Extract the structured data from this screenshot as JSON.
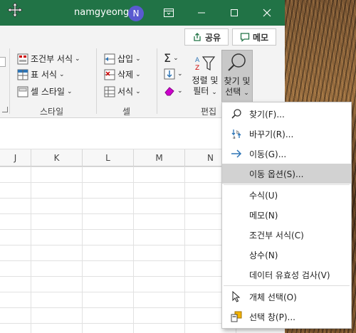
{
  "titlebar": {
    "username": "namgyeong",
    "avatar_initial": "N"
  },
  "ribbon": {
    "share_label": "공유",
    "memo_label": "메모",
    "styles": {
      "conditional_format": "조건부 서식",
      "table_format": "표 서식",
      "cell_style": "셀 스타일",
      "group_label": "스타일"
    },
    "cells": {
      "insert": "삽입",
      "delete": "삭제",
      "format": "서식",
      "group_label": "셀"
    },
    "editing": {
      "sort_filter_line1": "정렬 및",
      "sort_filter_line2": "필터",
      "find_select_line1": "찾기 및",
      "find_select_line2": "선택",
      "group_label": "편집"
    }
  },
  "columns": [
    "J",
    "K",
    "L",
    "M",
    "N"
  ],
  "menu": {
    "items": [
      {
        "label": "찾기(F)...",
        "icon": "search-icon"
      },
      {
        "label": "바꾸기(R)...",
        "icon": "replace-icon"
      },
      {
        "label": "이동(G)...",
        "icon": "arrow-right-icon"
      },
      {
        "label": "이동 옵션(S)...",
        "icon": "",
        "highlighted": true
      },
      {
        "label": "수식(U)",
        "icon": ""
      },
      {
        "label": "메모(N)",
        "icon": ""
      },
      {
        "label": "조건부 서식(C)",
        "icon": ""
      },
      {
        "label": "상수(N)",
        "icon": ""
      },
      {
        "label": "데이터 유효성 검사(V)",
        "icon": ""
      },
      {
        "label": "개체 선택(O)",
        "icon": "cursor-icon"
      },
      {
        "label": "선택 창(P)...",
        "icon": "selection-pane-icon"
      }
    ]
  },
  "colors": {
    "title_bar": "#217346",
    "menu_highlight": "#d2d2d2"
  }
}
